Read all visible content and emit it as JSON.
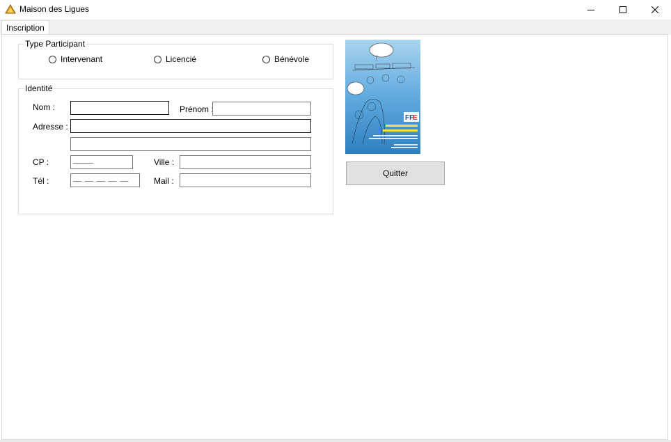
{
  "window": {
    "title": "Maison des Ligues",
    "icon": "triangle-logo-icon",
    "controls": [
      "minimize-icon",
      "maximize-icon",
      "close-icon"
    ]
  },
  "tabs": [
    {
      "label": "Inscription",
      "selected": true
    }
  ],
  "type_participant": {
    "legend": "Type Participant",
    "options": [
      {
        "label": "Intervenant",
        "checked": false
      },
      {
        "label": "Licencié",
        "checked": false
      },
      {
        "label": "Bénévole",
        "checked": false
      }
    ]
  },
  "identite": {
    "legend": "Identité",
    "nom_label": "Nom :",
    "nom_value": "",
    "prenom_label": "Prénom :",
    "prenom_value": "",
    "adresse_label": "Adresse :",
    "adresse1_value": "",
    "adresse2_value": "",
    "cp_label": "CP :",
    "cp_mask": "_____",
    "ville_label": "Ville :",
    "ville_value": "",
    "tel_label": "Tél :",
    "tel_mask": "__ __ __ __ __",
    "mail_label": "Mail :",
    "mail_value": ""
  },
  "poster": {
    "alt": "poster-image",
    "colors": {
      "top": "#a8d4f0",
      "bottom": "#2f7fc0",
      "accent": "#ffe14a",
      "logo_red": "#d8262c"
    }
  },
  "quit_button": {
    "label": "Quitter"
  }
}
